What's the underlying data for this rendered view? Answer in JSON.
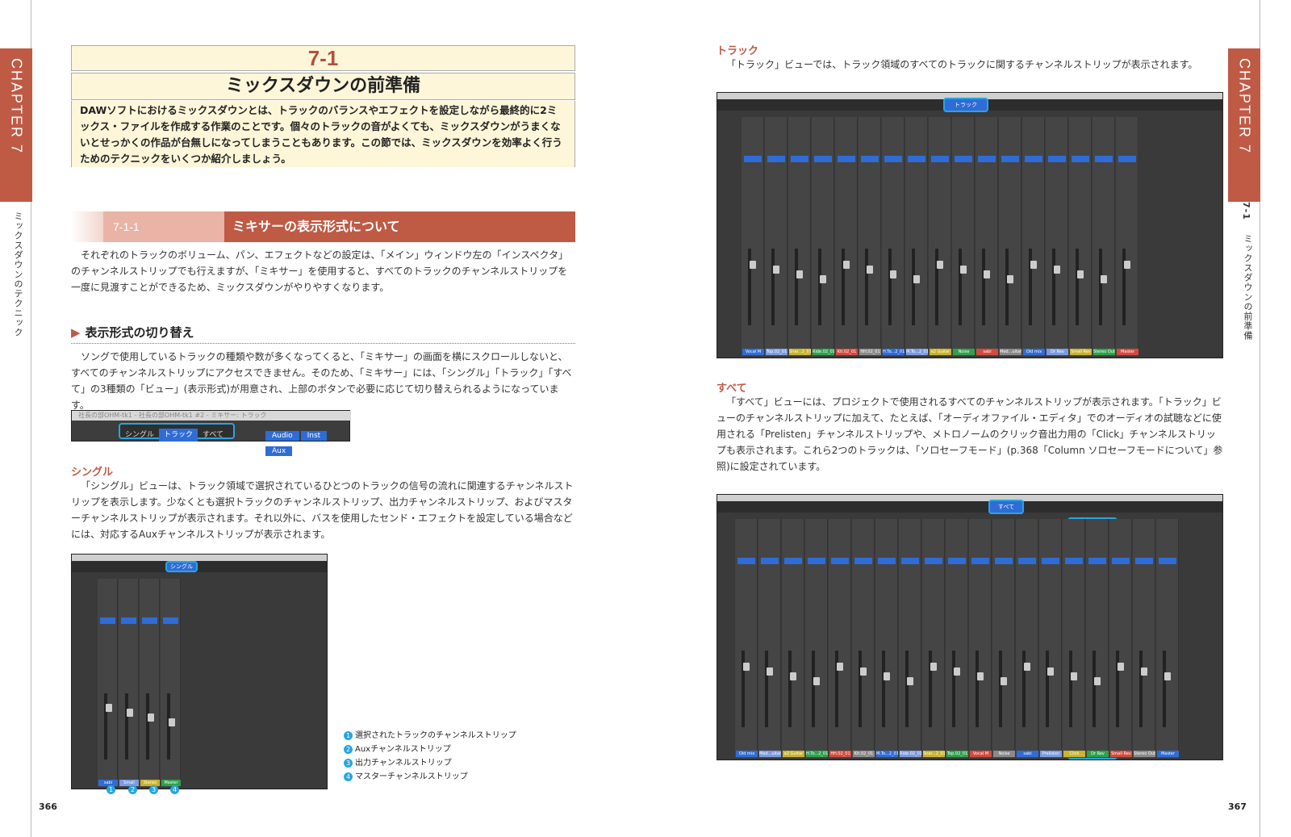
{
  "chapter_tab": "CHAPTER 7",
  "left_side": "ミックスダウンのテクニック",
  "right_side_num": "7-1",
  "right_side": "ミックスダウンの前準備",
  "section": {
    "number": "7-1",
    "title": "ミックスダウンの前準備",
    "intro": "DAWソフトにおけるミックスダウンとは、トラックのバランスやエフェクトを設定しながら最終的に2ミックス・ファイルを作成する作業のことです。個々のトラックの音がよくても、ミックスダウンがうまくないとせっかくの作品が台無しになってしまうこともあります。この節では、ミックスダウンを効率よく行うためのテクニックをいくつか紹介しましょう。"
  },
  "subsection": {
    "number": "7-1-1",
    "title": "ミキサーの表示形式について"
  },
  "para1": "それぞれのトラックのボリューム、パン、エフェクトなどの設定は、「メイン」ウィンドウ左の「インスペクタ」のチャンネルストリップでも行えますが、「ミキサー」を使用すると、すべてのトラックのチャンネルストリップを一度に見渡すことができるため、ミックスダウンがやりやすくなります。",
  "heading": "表示形式の切り替え",
  "para2": "ソングで使用しているトラックの種類や数が多くなってくると、「ミキサー」の画面を横にスクロールしないと、すべてのチャンネルストリップにアクセスできません。そのため、「ミキサー」には、「シングル」「トラック」「すべて」の3種類の「ビュー」(表示形式)が用意され、上部のボタンで必要に応じて切り替えられるようになっています。",
  "toolbar_shot": {
    "title": "社長の部OHM-tk1 - 社長の部OHM-tk1 #2 - ミキサー: トラック",
    "seg": [
      "シングル",
      "トラック",
      "すべて"
    ],
    "btns": [
      "Audio",
      "Inst",
      "Aux"
    ]
  },
  "single": {
    "label": "シングル",
    "text": "「シングル」ビューは、トラック領域で選択されているひとつのトラックの信号の流れに関連するチャンネルストリップを表示します。少なくとも選択トラックのチャンネルストリップ、出力チャンネルストリップ、およびマスターチャンネルストリップが表示されます。それ以外に、バスを使用したセンド・エフェクトを設定している場合などには、対応するAuxチャンネルストリップが表示されます。",
    "hl": "シングル",
    "strips": [
      "sabi Guitar",
      "Small Rev",
      "Stereo Out",
      "Master"
    ]
  },
  "legend": [
    {
      "n": "1",
      "text": "選択されたトラックのチャンネルストリップ"
    },
    {
      "n": "2",
      "text": "Auxチャンネルストリップ"
    },
    {
      "n": "3",
      "text": "出力チャンネルストリップ"
    },
    {
      "n": "4",
      "text": "マスターチャンネルストリップ"
    }
  ],
  "track": {
    "label": "トラック",
    "text": "「トラック」ビューでは、トラック領域のすべてのトラックに関するチャンネルストリップが表示されます。",
    "hl": "トラック",
    "strips": [
      "Vocal M",
      "Top.02_01",
      "Snar...2_01",
      "Ride.02_01",
      "Kit.02_01",
      "HH.02_01",
      "H.To...2_01",
      "M.To...2_01",
      "e2 Guitar",
      "Noise Guitar",
      "sabi Guitar",
      "Med...uitar",
      "Old mix",
      "Dr Rev",
      "Small Rev",
      "Stereo Out",
      "Master"
    ]
  },
  "all": {
    "label": "すべて",
    "text": "「すべて」ビューには、プロジェクトで使用されるすべてのチャンネルストリップが表示されます。「トラック」ビューのチャンネルストリップに加えて、たとえば、「オーディオファイル・エディタ」でのオーディオの試聴などに使用される「Prelisten」チャンネルストリップや、メトロノームのクリック音出力用の「Click」チャンネルストリップも表示されます。これら2つのトラックは、「ソロセーフモード」(p.368「Column ソロセーフモードについて」参照)に設定されています。",
    "hl": "すべて",
    "strips": [
      "Old mix",
      "Med...uitar",
      "e2 Guitar",
      "H.To...2_01",
      "HH.02_01",
      "Kit.02_01",
      "M.To...2_01",
      "Ride.02_01",
      "Snar...2_01",
      "Top.02_01",
      "Vocal M",
      "Noise Guitar",
      "sabi Guitar",
      "Prelisten",
      "Click",
      "Dr Rev",
      "Small Rev",
      "Stereo Out",
      "Master"
    ]
  },
  "page_left": "366",
  "page_right": "367",
  "colors": {
    "accent": "#bf5a45",
    "highlight": "#27a6e0",
    "note_bg": "#fdf6d9"
  }
}
